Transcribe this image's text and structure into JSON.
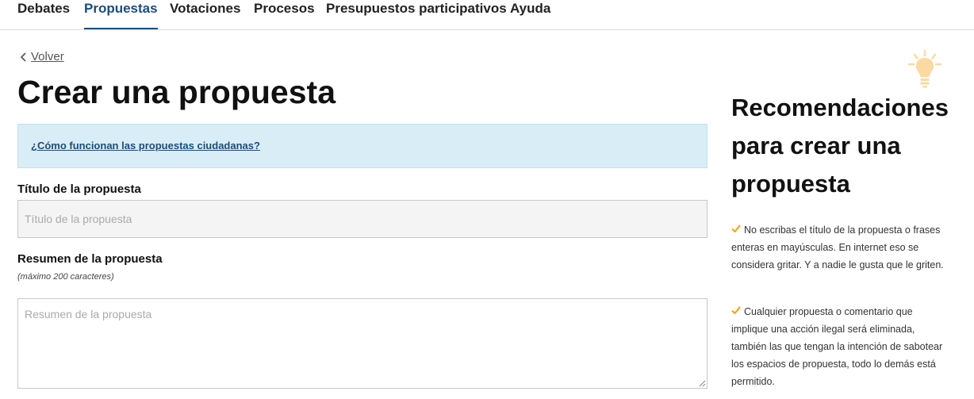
{
  "nav": {
    "items": [
      {
        "label": "Debates"
      },
      {
        "label": "Propuestas",
        "active": true
      },
      {
        "label": "Votaciones"
      },
      {
        "label": "Procesos"
      },
      {
        "label": "Presupuestos participativos"
      },
      {
        "label": "Ayuda"
      }
    ],
    "active_color": "#1a4d7a"
  },
  "back": {
    "label": "Volver"
  },
  "page": {
    "title": "Crear una propuesta"
  },
  "callout": {
    "link": "¿Cómo funcionan las propuestas ciudadanas?",
    "background": "#d9edf7"
  },
  "form": {
    "title_label": "Título de la propuesta",
    "title_placeholder": "Título de la propuesta",
    "summary_label": "Resumen de la propuesta",
    "summary_hint": "(máximo 200 caracteres)",
    "summary_placeholder": "Resumen de la propuesta"
  },
  "sidebar": {
    "icon": "lightbulb-icon",
    "title": "Recomendaciones para crear una propuesta",
    "tips": [
      {
        "text": "No escribas el título de la propuesta o frases enteras en mayúsculas. En internet eso se considera gritar. Y a nadie le gusta que le griten."
      },
      {
        "text": "Cualquier propuesta o comentario que implique una acción ilegal será eliminada, también las que tengan la intención de sabotear los espacios de propuesta, todo lo demás está permitido."
      }
    ],
    "accent_color": "#f5a623"
  }
}
